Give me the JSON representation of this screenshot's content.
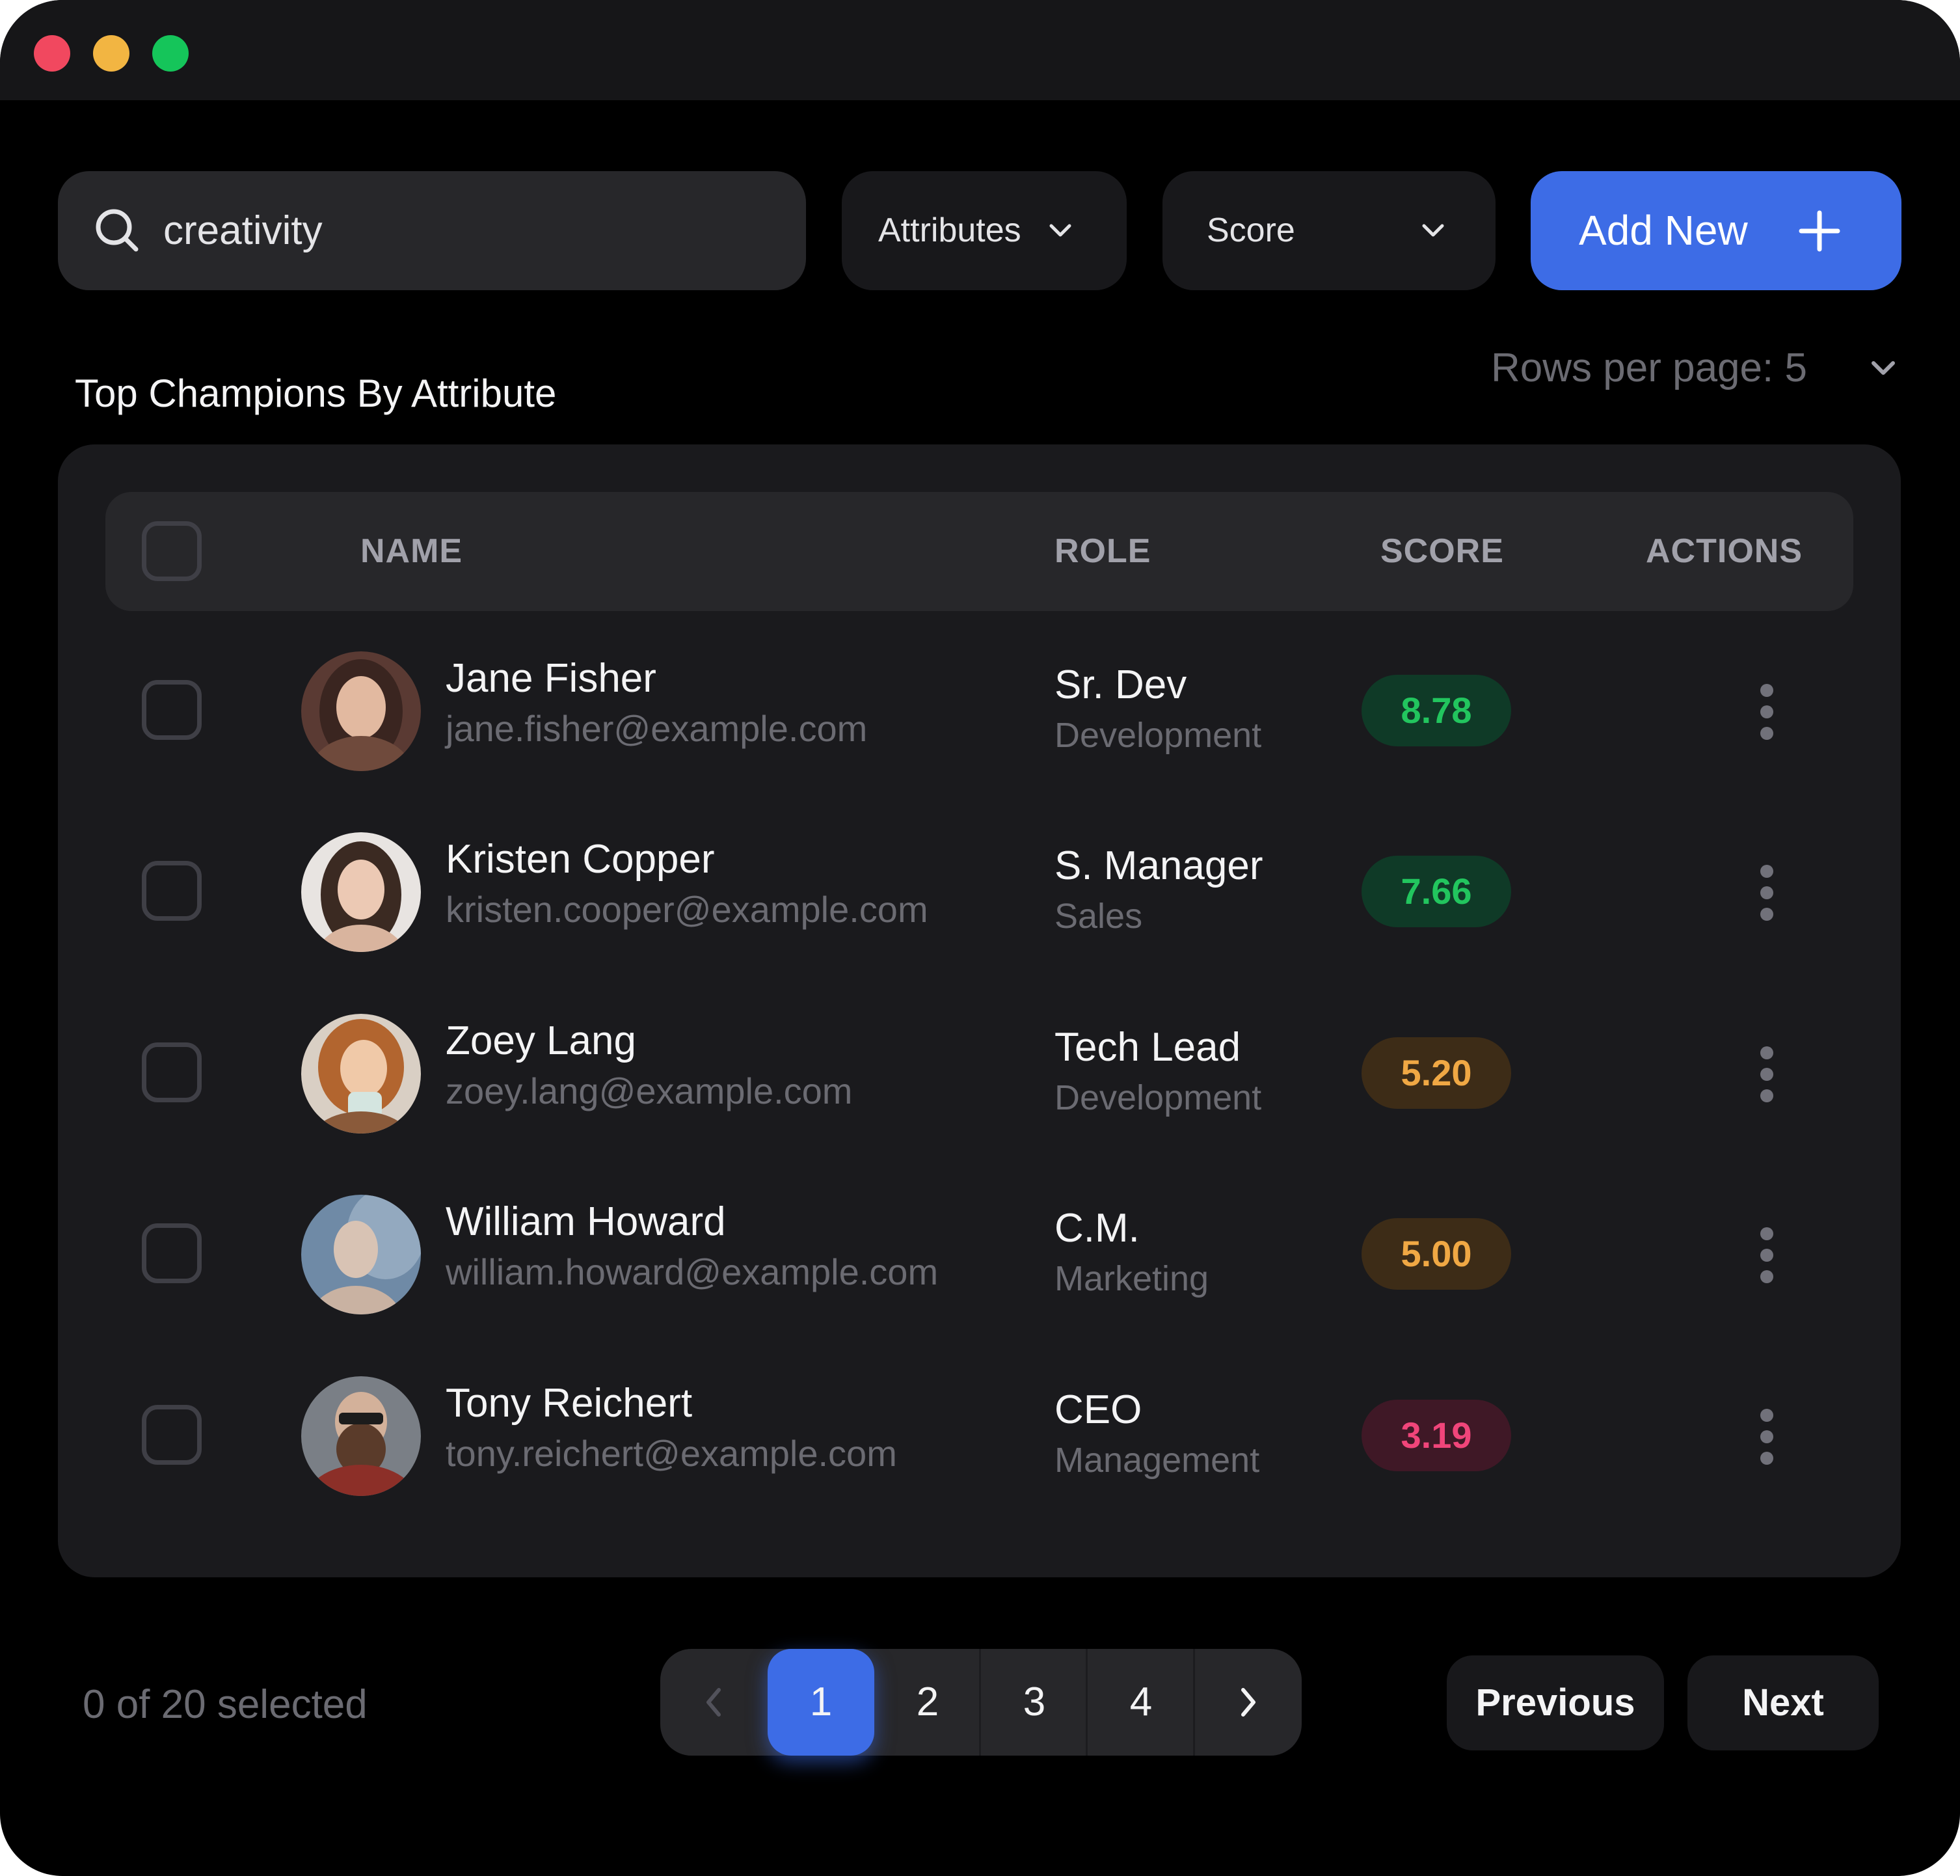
{
  "search": {
    "value": "creativity"
  },
  "filters": {
    "attributes_label": "Attributes",
    "score_label": "Score"
  },
  "add_button": {
    "label": "Add New"
  },
  "section": {
    "title": "Top Champions By Attribute",
    "rows_per_page": "Rows per page: 5"
  },
  "table": {
    "columns": {
      "name": "NAME",
      "role": "ROLE",
      "score": "SCORE",
      "actions": "ACTIONS"
    },
    "rows": [
      {
        "name": "Jane Fisher",
        "email": "jane.fisher@example.com",
        "role": "Sr. Dev",
        "department": "Development",
        "score": "8.78",
        "score_level": "high"
      },
      {
        "name": "Kristen Copper",
        "email": "kristen.cooper@example.com",
        "role": "S. Manager",
        "department": "Sales",
        "score": "7.66",
        "score_level": "high"
      },
      {
        "name": "Zoey Lang",
        "email": "zoey.lang@example.com",
        "role": "Tech Lead",
        "department": "Development",
        "score": "5.20",
        "score_level": "medium"
      },
      {
        "name": "William Howard",
        "email": "william.howard@example.com",
        "role": "C.M.",
        "department": "Marketing",
        "score": "5.00",
        "score_level": "medium"
      },
      {
        "name": "Tony Reichert",
        "email": "tony.reichert@example.com",
        "role": "CEO",
        "department": "Management",
        "score": "3.19",
        "score_level": "low"
      }
    ]
  },
  "footer": {
    "selected_text": "0 of 20 selected",
    "pages": [
      "1",
      "2",
      "3",
      "4"
    ],
    "current_page": "1",
    "previous_label": "Previous",
    "next_label": "Next"
  },
  "colors": {
    "accent": "#3d6ce6",
    "score_high": "#22c55e",
    "score_medium": "#f0a844",
    "score_low": "#f0457a"
  }
}
